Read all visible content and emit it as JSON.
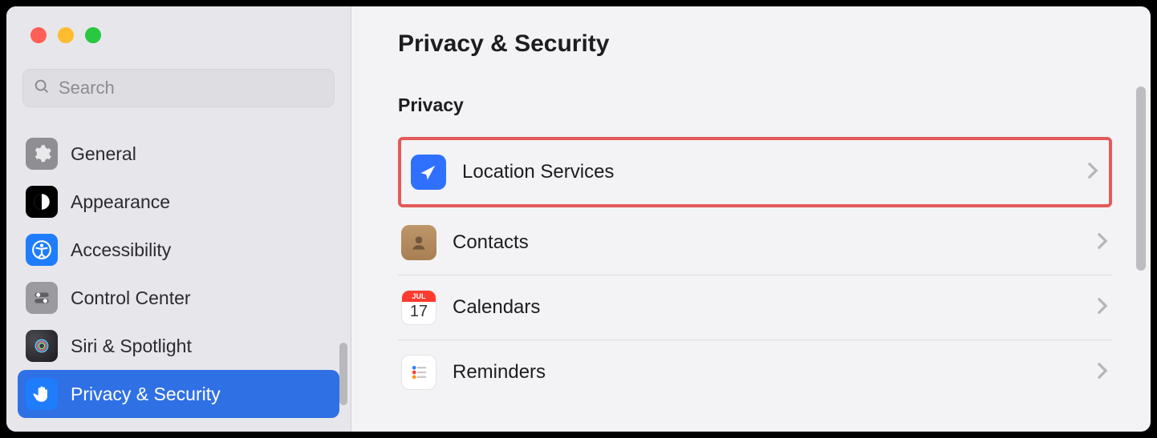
{
  "window": {
    "search_placeholder": "Search"
  },
  "sidebar": {
    "items": [
      {
        "label": "General"
      },
      {
        "label": "Appearance"
      },
      {
        "label": "Accessibility"
      },
      {
        "label": "Control Center"
      },
      {
        "label": "Siri & Spotlight"
      },
      {
        "label": "Privacy & Security"
      }
    ],
    "active_index": 5
  },
  "main": {
    "title": "Privacy & Security",
    "section": "Privacy",
    "rows": [
      {
        "label": "Location Services",
        "highlighted": true
      },
      {
        "label": "Contacts"
      },
      {
        "label": "Calendars"
      },
      {
        "label": "Reminders"
      }
    ],
    "calendar_icon": {
      "month": "JUL",
      "day": "17"
    }
  },
  "colors": {
    "highlight_border": "#e35a5a",
    "selection": "#2f70e5"
  }
}
